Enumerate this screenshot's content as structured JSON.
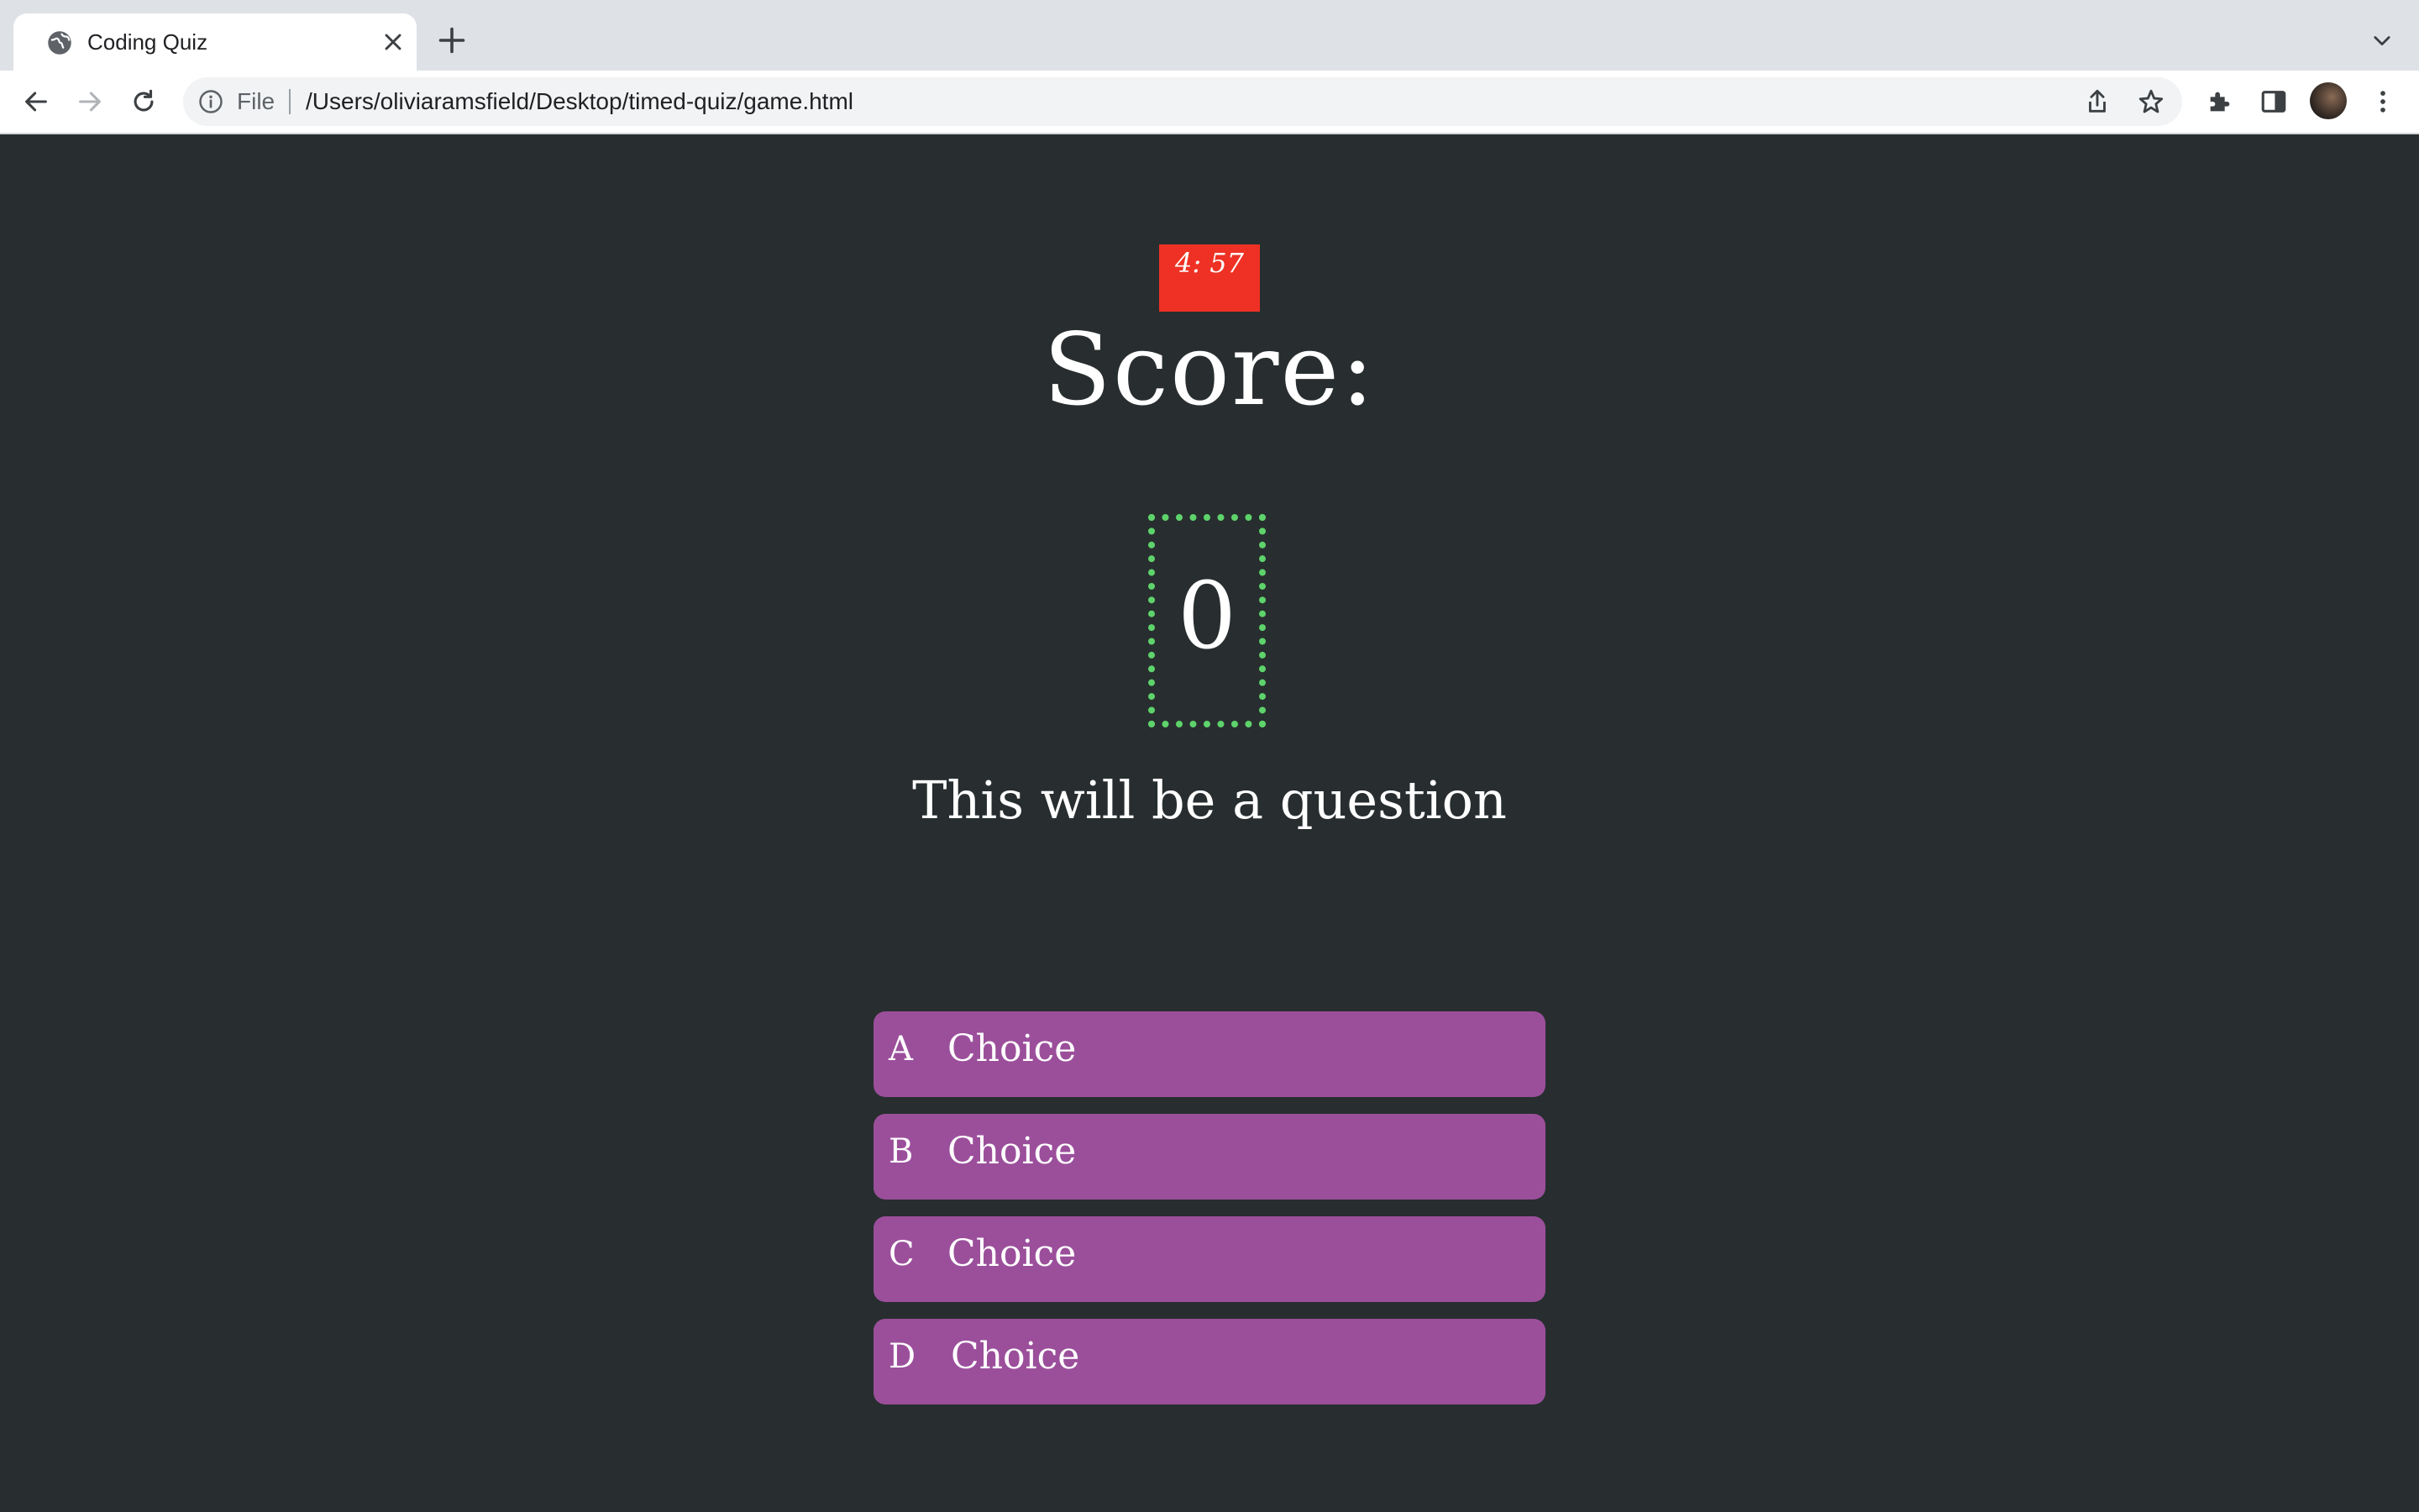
{
  "browser": {
    "tab": {
      "title": "Coding Quiz",
      "favicon": "globe-icon"
    },
    "toolbar": {
      "scheme_label": "File",
      "url": "/Users/oliviaramsfield/Desktop/timed-quiz/game.html"
    },
    "icons": {
      "back": "back-arrow-icon",
      "forward": "forward-arrow-icon",
      "reload": "reload-icon",
      "info": "info-icon",
      "share": "share-icon",
      "bookmark": "star-icon",
      "extensions": "puzzle-icon",
      "side_panel": "side-panel-icon",
      "menu": "kebab-menu-icon",
      "tab_search": "chevron-down-icon",
      "new_tab": "plus-icon",
      "close_tab": "close-icon"
    }
  },
  "quiz": {
    "timer": "4: 57",
    "score_label": "Score:",
    "score_value": "0",
    "question": "This will be a question",
    "choices": [
      {
        "letter": "A",
        "text": "Choice"
      },
      {
        "letter": "B",
        "text": "Choice"
      },
      {
        "letter": "C",
        "text": "Choice"
      },
      {
        "letter": "D",
        "text": "Choice"
      }
    ]
  },
  "colors": {
    "page_background": "#282e2f",
    "timer_background": "#ee3124",
    "score_border": "#5ed36b",
    "choice_background": "#9b4f9b",
    "text": "#ffffff"
  }
}
